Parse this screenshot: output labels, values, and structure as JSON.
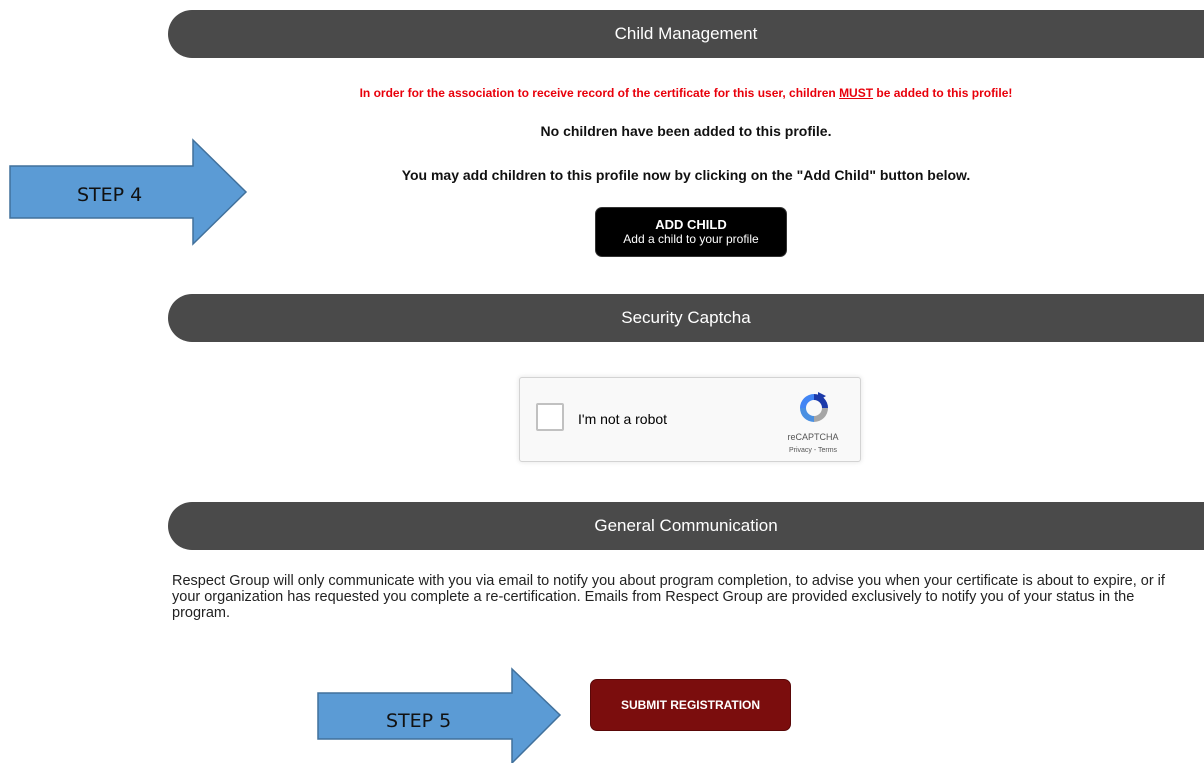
{
  "child_management": {
    "header": "Child Management",
    "warning_pre": "In order for the association to receive record of the certificate for this user, children ",
    "warning_emph": "MUST",
    "warning_post": " be added to this profile!",
    "no_children_text": "No children have been added to this profile.",
    "instruction_text": "You may add children to this profile now by clicking on the \"Add Child\" button below.",
    "add_child_button": {
      "main": "ADD CHILD",
      "sub": "Add a child to your profile"
    }
  },
  "security_captcha": {
    "header": "Security Captcha",
    "checkbox_label": "I'm not a robot",
    "brand": "reCAPTCHA",
    "terms": "Privacy - Terms"
  },
  "general_communication": {
    "header": "General Communication",
    "body": "Respect Group will only communicate with you via email to notify you about program completion, to advise you when your certificate is about to expire, or if your organization has requested you complete a re-certification. Emails from Respect Group are provided exclusively to notify you of your status in the program."
  },
  "submit_button": {
    "label": "SUBMIT REGISTRATION"
  },
  "annotations": {
    "step4": "STEP 4",
    "step5": "STEP 5"
  },
  "colors": {
    "section_bar": "#4a4a4a",
    "warning": "#e8000b",
    "submit": "#7b0d0d",
    "arrow_fill": "#5b9bd5",
    "arrow_stroke": "#41719c"
  }
}
